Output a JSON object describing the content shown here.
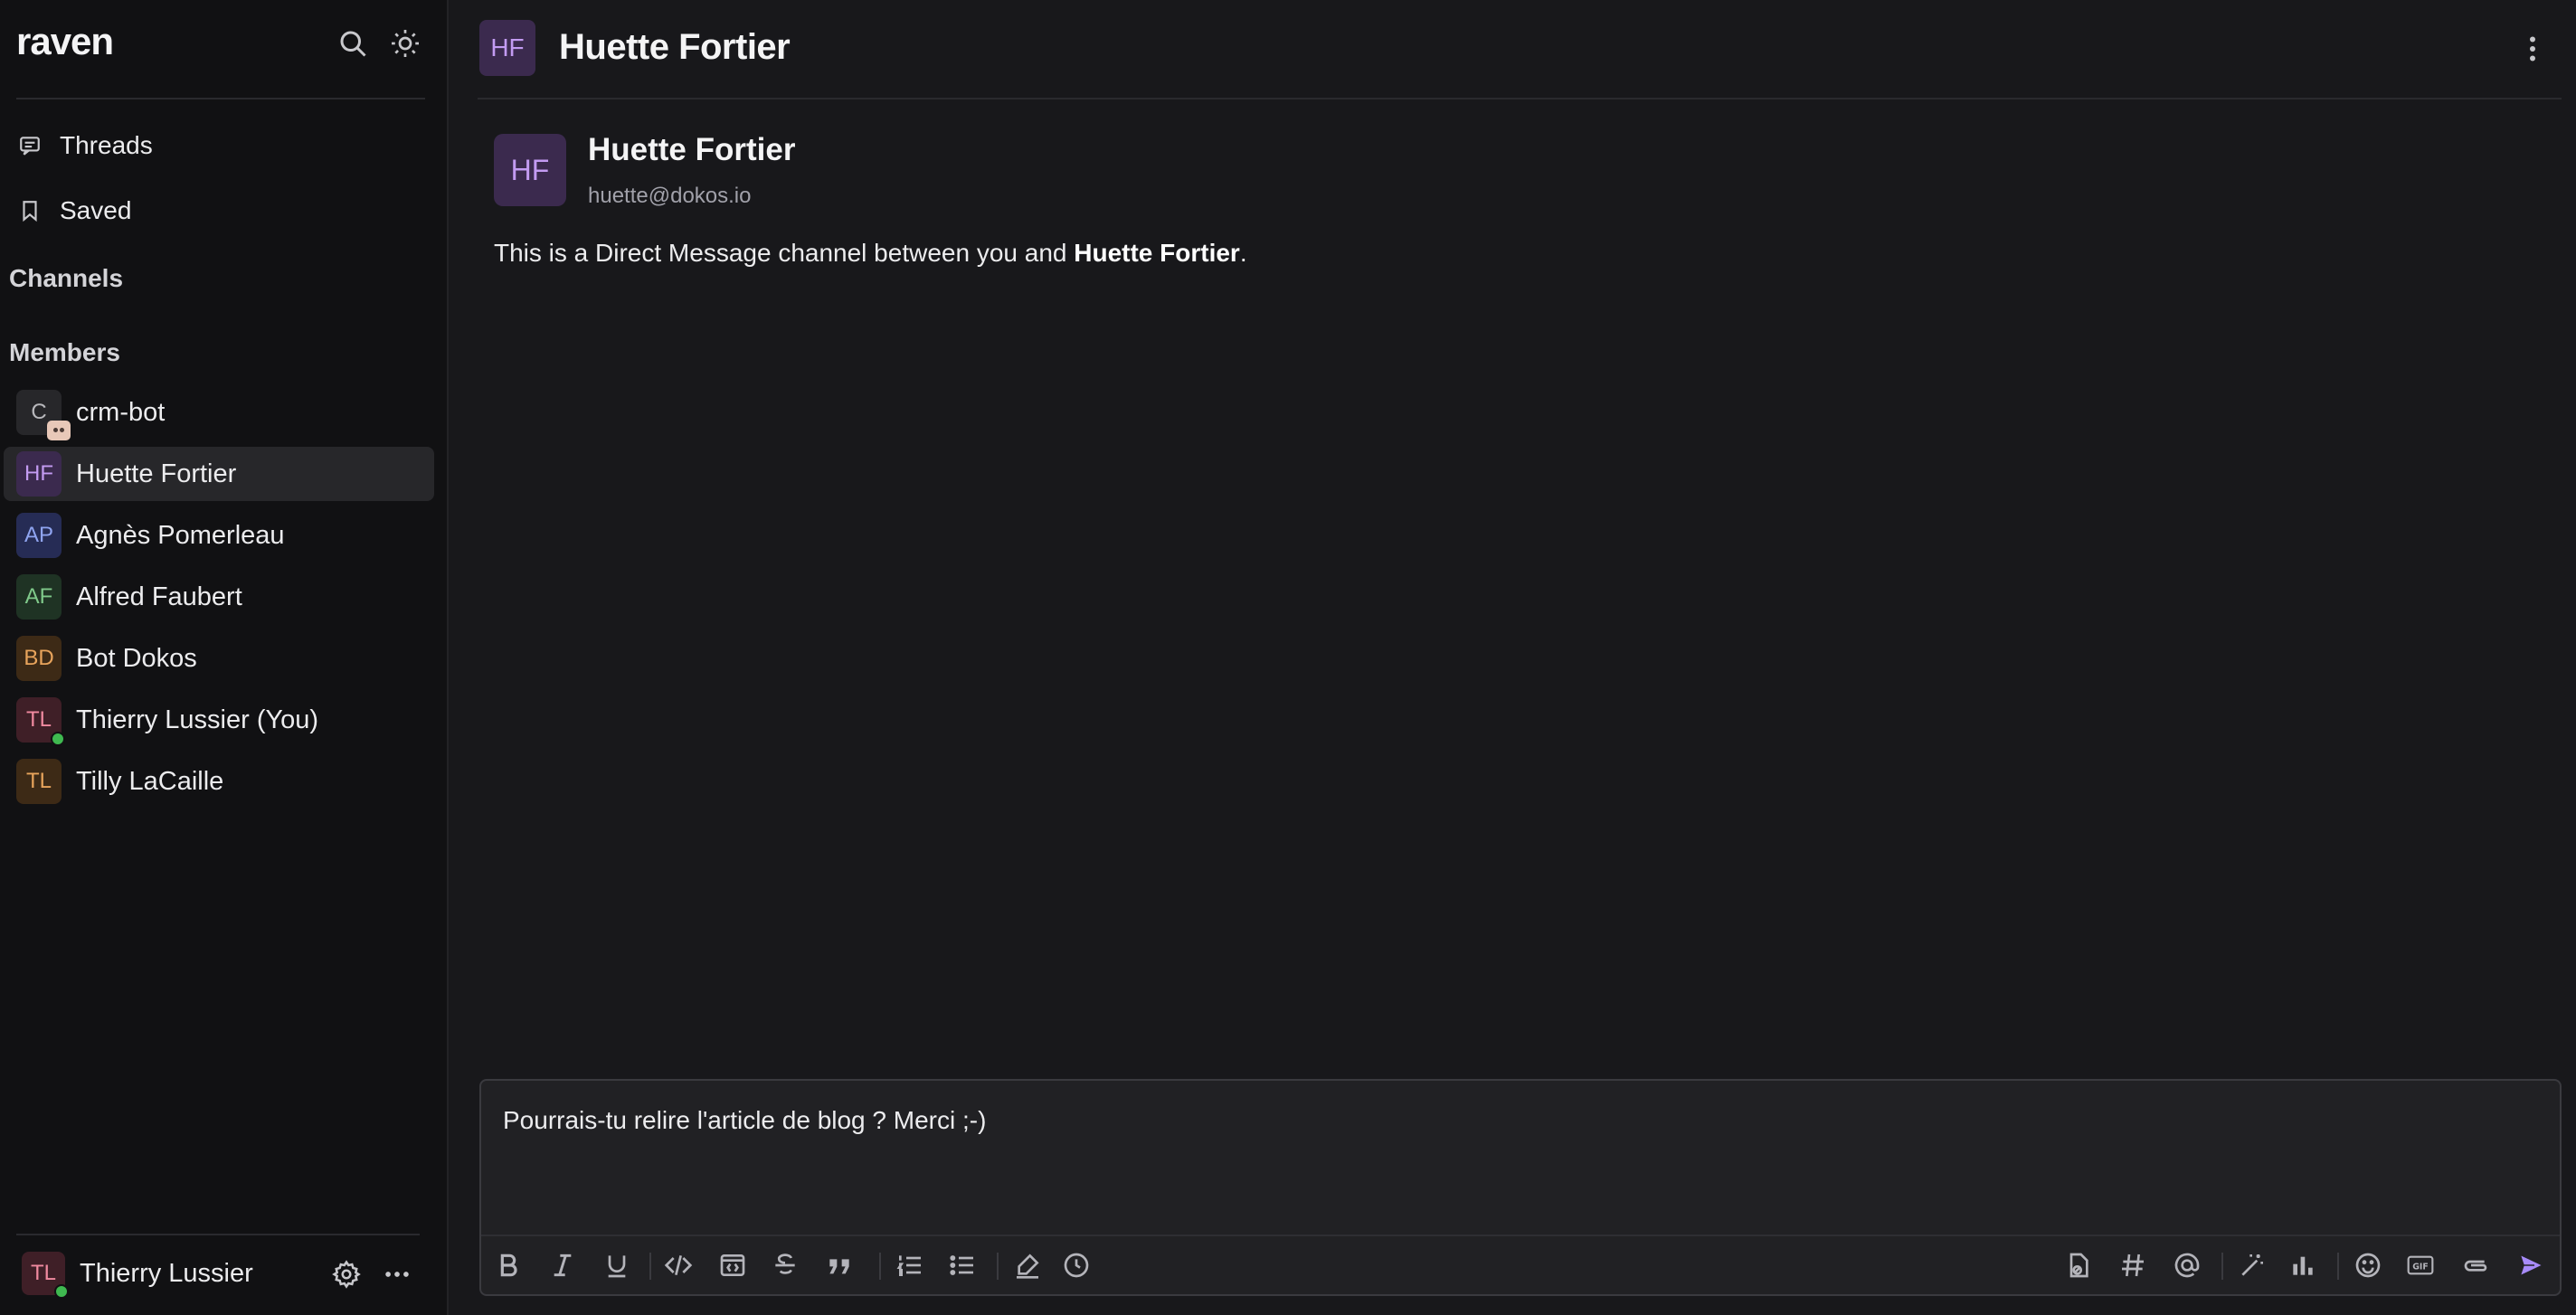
{
  "app": {
    "logo": "raven"
  },
  "sidebar": {
    "nav": [
      {
        "label": "Threads",
        "icon": "threads-icon"
      },
      {
        "label": "Saved",
        "icon": "bookmark-icon"
      }
    ],
    "sections": {
      "channels": "Channels",
      "members": "Members"
    },
    "members": [
      {
        "initials": "C",
        "name": "crm-bot",
        "bg": "#27272a",
        "fg": "#b8b8bc",
        "bot": true
      },
      {
        "initials": "HF",
        "name": "Huette Fortier",
        "bg": "#3b2a4e",
        "fg": "#c39bf2",
        "active": true
      },
      {
        "initials": "AP",
        "name": "Agnès Pomerleau",
        "bg": "#262c55",
        "fg": "#8fa4f0"
      },
      {
        "initials": "AF",
        "name": "Alfred Faubert",
        "bg": "#1f3324",
        "fg": "#7fc98a"
      },
      {
        "initials": "BD",
        "name": "Bot Dokos",
        "bg": "#3d2a16",
        "fg": "#e8a45c"
      },
      {
        "initials": "TL",
        "name": "Thierry Lussier (You)",
        "bg": "#3f1f27",
        "fg": "#f08aa0",
        "online": true
      },
      {
        "initials": "TL",
        "name": "Tilly LaCaille",
        "bg": "#3d2a16",
        "fg": "#e8a45c"
      }
    ],
    "footer": {
      "initials": "TL",
      "name": "Thierry Lussier"
    }
  },
  "header": {
    "initials": "HF",
    "title": "Huette Fortier"
  },
  "intro": {
    "initials": "HF",
    "name": "Huette Fortier",
    "email": "huette@dokos.io",
    "text_prefix": "This is a Direct Message channel between you and ",
    "text_name": "Huette Fortier",
    "text_suffix": "."
  },
  "composer": {
    "value": "Pourrais-tu relire l'article de blog ? Merci ;-)"
  },
  "colors": {
    "accent": "#a78bfa",
    "online": "#3fb950"
  }
}
